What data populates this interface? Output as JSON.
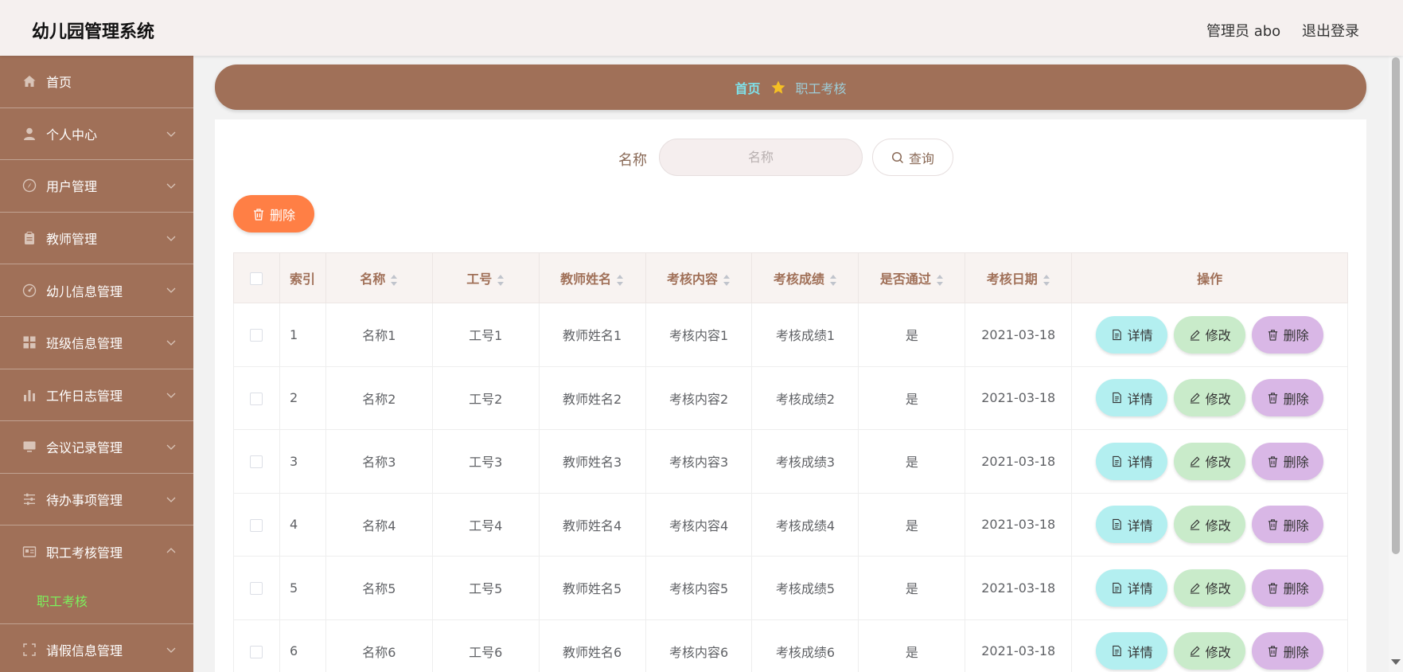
{
  "header": {
    "title": "幼儿园管理系统",
    "user": "管理员 abo",
    "logout": "退出登录"
  },
  "sidebar": {
    "items": [
      {
        "label": "首页",
        "icon": "home-icon"
      },
      {
        "label": "个人中心",
        "icon": "user-icon"
      },
      {
        "label": "用户管理",
        "icon": "compass-icon"
      },
      {
        "label": "教师管理",
        "icon": "clipboard-icon"
      },
      {
        "label": "幼儿信息管理",
        "icon": "gauge-icon"
      },
      {
        "label": "班级信息管理",
        "icon": "grid-icon"
      },
      {
        "label": "工作日志管理",
        "icon": "bar-chart-icon"
      },
      {
        "label": "会议记录管理",
        "icon": "monitor-icon"
      },
      {
        "label": "待办事项管理",
        "icon": "sliders-icon"
      },
      {
        "label": "职工考核管理",
        "icon": "id-card-icon"
      },
      {
        "label": "请假信息管理",
        "icon": "frame-icon"
      }
    ],
    "active_sub": "职工考核"
  },
  "breadcrumb": {
    "home": "首页",
    "current": "职工考核"
  },
  "search": {
    "label": "名称",
    "placeholder": "名称",
    "button": "查询"
  },
  "toolbar": {
    "delete": "删除"
  },
  "table": {
    "headers": {
      "index": "索引",
      "name": "名称",
      "job_no": "工号",
      "teacher": "教师姓名",
      "content": "考核内容",
      "score": "考核成绩",
      "passed": "是否通过",
      "date": "考核日期",
      "ops": "操作"
    },
    "rows": [
      {
        "index": "1",
        "name": "名称1",
        "job_no": "工号1",
        "teacher": "教师姓名1",
        "content": "考核内容1",
        "score": "考核成绩1",
        "passed": "是",
        "date": "2021-03-18"
      },
      {
        "index": "2",
        "name": "名称2",
        "job_no": "工号2",
        "teacher": "教师姓名2",
        "content": "考核内容2",
        "score": "考核成绩2",
        "passed": "是",
        "date": "2021-03-18"
      },
      {
        "index": "3",
        "name": "名称3",
        "job_no": "工号3",
        "teacher": "教师姓名3",
        "content": "考核内容3",
        "score": "考核成绩3",
        "passed": "是",
        "date": "2021-03-18"
      },
      {
        "index": "4",
        "name": "名称4",
        "job_no": "工号4",
        "teacher": "教师姓名4",
        "content": "考核内容4",
        "score": "考核成绩4",
        "passed": "是",
        "date": "2021-03-18"
      },
      {
        "index": "5",
        "name": "名称5",
        "job_no": "工号5",
        "teacher": "教师姓名5",
        "content": "考核内容5",
        "score": "考核成绩5",
        "passed": "是",
        "date": "2021-03-18"
      },
      {
        "index": "6",
        "name": "名称6",
        "job_no": "工号6",
        "teacher": "教师姓名6",
        "content": "考核内容6",
        "score": "考核成绩6",
        "passed": "是",
        "date": "2021-03-18"
      }
    ],
    "actions": {
      "detail": "详情",
      "edit": "修改",
      "delete": "删除"
    }
  },
  "colors": {
    "sidebar_bg": "#a07058",
    "accent_delete": "#ff7f45",
    "active_sub": "#7cf05c",
    "crumb_home": "#7fe1ea",
    "btn_detail": "#b3eff0",
    "btn_edit": "#c9ebca",
    "btn_delete": "#d9b7e6"
  }
}
